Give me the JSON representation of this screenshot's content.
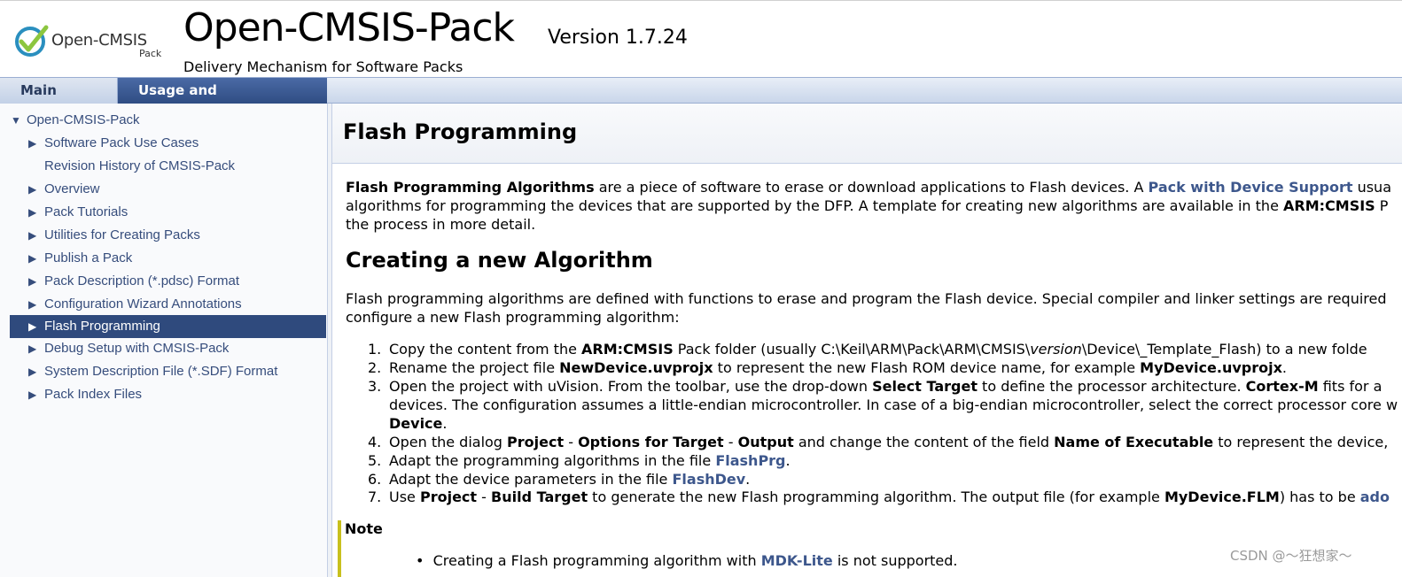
{
  "header": {
    "logo_text": "Open-CMSIS",
    "logo_sub": "Pack",
    "project_name": "Open-CMSIS-Pack",
    "project_number": "Version 1.7.24",
    "project_brief": "Delivery Mechanism for Software Packs"
  },
  "tabs": [
    {
      "label": "Main Page"
    },
    {
      "label": "Usage and Description"
    }
  ],
  "nav": {
    "root": "Open-CMSIS-Pack",
    "items": [
      {
        "label": "Software Pack Use Cases",
        "arrow": "▶"
      },
      {
        "label": "Revision History of CMSIS-Pack",
        "arrow": ""
      },
      {
        "label": "Overview",
        "arrow": "▶"
      },
      {
        "label": "Pack Tutorials",
        "arrow": "▶"
      },
      {
        "label": "Utilities for Creating Packs",
        "arrow": "▶"
      },
      {
        "label": "Publish a Pack",
        "arrow": "▶"
      },
      {
        "label": "Pack Description (*.pdsc) Format",
        "arrow": "▶"
      },
      {
        "label": "Configuration Wizard Annotations",
        "arrow": "▶"
      },
      {
        "label": "Flash Programming",
        "arrow": "▶"
      },
      {
        "label": "Debug Setup with CMSIS-Pack",
        "arrow": "▶"
      },
      {
        "label": "System Description File (*.SDF) Format",
        "arrow": "▶"
      },
      {
        "label": "Pack Index Files",
        "arrow": "▶"
      }
    ]
  },
  "content": {
    "title": "Flash Programming",
    "intro": {
      "p1_bold": "Flash Programming Algorithms",
      "p1_text": " are a piece of software to erase or download applications to Flash devices. A ",
      "p1_link": "Pack with Device Support",
      "p1_tail": " usua",
      "l2_text": "algorithms for programming the devices that are supported by the DFP. A template for creating new algorithms are available in the ",
      "l2_bold": "ARM:CMSIS",
      "l2_tail": " P",
      "l3_text": "the process in more detail."
    },
    "h2": "Creating a new Algorithm",
    "para2": {
      "l1": "Flash programming algorithms are defined with functions to erase and program the Flash device. Special compiler and linker settings are required",
      "l2": "configure a new Flash programming algorithm:"
    },
    "steps": {
      "s1": {
        "num": "1.",
        "a": "Copy the content from the ",
        "b": "ARM:CMSIS",
        "c": " Pack folder (usually C:\\Keil\\ARM\\Pack\\ARM\\CMSIS\\",
        "i": "version",
        "d": "\\Device\\_Template_Flash) to a new folde"
      },
      "s2": {
        "num": "2.",
        "a": "Rename the project file ",
        "b": "NewDevice.uvprojx",
        "c": " to represent the new Flash ROM device name, for example ",
        "d": "MyDevice.uvprojx",
        "e": "."
      },
      "s3": {
        "num": "3.",
        "a": "Open the project with uVision. From the toolbar, use the drop-down ",
        "b": "Select Target",
        "c": " to define the processor architecture. ",
        "d": "Cortex-M",
        "e": " fits for a"
      },
      "s3b": "devices. The configuration assumes a little-endian microcontroller. In case of a big-endian microcontroller, select the correct processor core w",
      "s3c": {
        "b": "Device",
        "e": "."
      },
      "s4": {
        "num": "4.",
        "a": "Open the dialog ",
        "b": "Project",
        "c": " - ",
        "d": "Options for Target",
        "e": " - ",
        "f": "Output",
        "g": " and change the content of the field ",
        "h": "Name of Executable",
        "i": " to represent the device,"
      },
      "s5": {
        "num": "5.",
        "a": "Adapt the programming algorithms in the file ",
        "link": "FlashPrg",
        "e": "."
      },
      "s6": {
        "num": "6.",
        "a": "Adapt the device parameters in the file ",
        "link": "FlashDev",
        "e": "."
      },
      "s7": {
        "num": "7.",
        "a": "Use ",
        "b": "Project",
        "c": " - ",
        "d": "Build Target",
        "e": " to generate the new Flash programming algorithm. The output file (for example ",
        "f": "MyDevice.FLM",
        "g": ") has to be ",
        "link": "ado"
      }
    },
    "note": {
      "title": "Note",
      "item_a": "Creating a Flash programming algorithm with ",
      "item_link": "MDK-Lite",
      "item_b": " is not supported."
    }
  },
  "watermark": "CSDN @～狂想家～",
  "colors": {
    "link": "#3d578c",
    "tab_active": "#2f4d83",
    "nav_selected": "#2f4a7d",
    "note_bar": "#c8c01e"
  }
}
